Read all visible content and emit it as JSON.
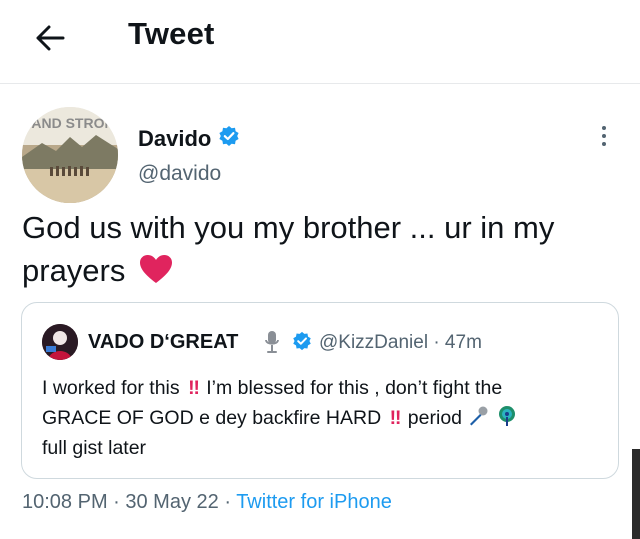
{
  "header": {
    "title": "Tweet"
  },
  "author": {
    "avatar_text": "STAND STRONG",
    "name": "Davido",
    "handle": "@davido"
  },
  "tweet": {
    "text": "God us with you my brother ... ur in my prayers"
  },
  "quoted": {
    "name": "VADO D‘GREAT",
    "handle_time": "@KizzDaniel · 47m",
    "line1_a": "I worked for this",
    "line1_b": "I’m blessed for this , don’t fight the",
    "line2_a": "GRACE OF GOD e dey backfire HARD",
    "line2_b": "period",
    "line3": "full gist later"
  },
  "meta": {
    "time_date": "10:08 PM · 30 May 22 · ",
    "source": "Twitter for iPhone"
  },
  "colors": {
    "accent": "#1d9bf0",
    "secondary_text": "#536471",
    "heart": "#e0245e"
  }
}
